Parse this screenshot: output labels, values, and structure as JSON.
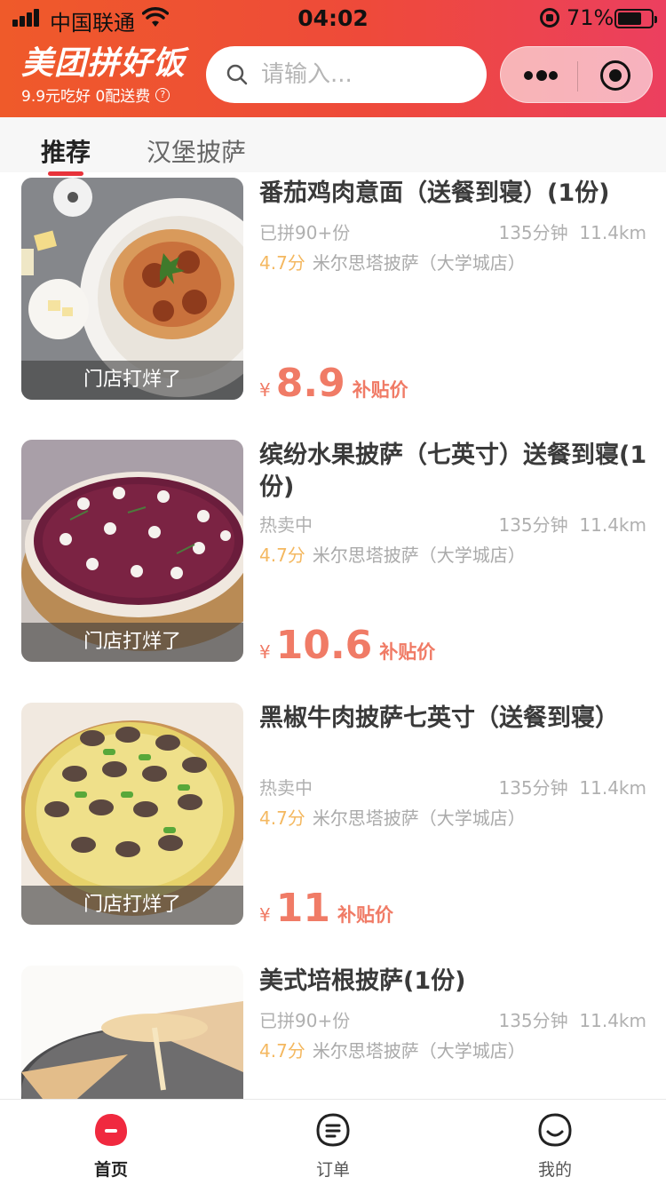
{
  "status_bar": {
    "carrier": "中国联通",
    "time": "04:02",
    "battery_pct": "71%",
    "battery_level": 0.71
  },
  "header": {
    "brand_title": "美团拼好饭",
    "brand_subtitle": "9.9元吃好 0配送费",
    "search_placeholder": "请输入...",
    "accent_color": "#ee4a3a"
  },
  "tabs": [
    {
      "label": "推荐",
      "active": true
    },
    {
      "label": "汉堡披萨",
      "active": false
    }
  ],
  "products": [
    {
      "title": "番茄鸡肉意面（送餐到寝）(1份)",
      "sold": "已拼90+份",
      "time": "135分钟",
      "distance": "11.4km",
      "rating": "4.7分",
      "store": "米尔思塔披萨（大学城店）",
      "currency": "¥",
      "price": "8.9",
      "price_tag": "补贴价",
      "overlay": "门店打烊了",
      "image": "pasta"
    },
    {
      "title": "缤纷水果披萨（七英寸）送餐到寝(1份)",
      "sold": "热卖中",
      "time": "135分钟",
      "distance": "11.4km",
      "rating": "4.7分",
      "store": "米尔思塔披萨（大学城店）",
      "currency": "¥",
      "price": "10.6",
      "price_tag": "补贴价",
      "overlay": "门店打烊了",
      "image": "berry-pizza"
    },
    {
      "title": "黑椒牛肉披萨七英寸（送餐到寝）",
      "sold": "热卖中",
      "time": "135分钟",
      "distance": "11.4km",
      "rating": "4.7分",
      "store": "米尔思塔披萨（大学城店）",
      "currency": "¥",
      "price": "11",
      "price_tag": "补贴价",
      "overlay": "门店打烊了",
      "image": "beef-pizza"
    },
    {
      "title": "美式培根披萨(1份)",
      "sold": "已拼90+份",
      "time": "135分钟",
      "distance": "11.4km",
      "rating": "4.7分",
      "store": "米尔思塔披萨（大学城店）",
      "image": "bacon-pizza"
    }
  ],
  "bottom_nav": [
    {
      "label": "首页",
      "icon": "home-icon",
      "active": true
    },
    {
      "label": "订单",
      "icon": "orders-icon",
      "active": false
    },
    {
      "label": "我的",
      "icon": "profile-icon",
      "active": false
    }
  ]
}
